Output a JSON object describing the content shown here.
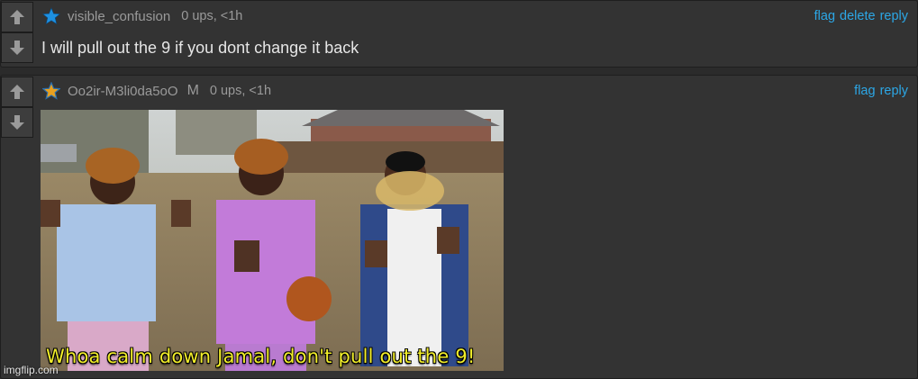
{
  "comments": [
    {
      "username": "visible_confusion",
      "stats": "0 ups, <1h",
      "actions": {
        "flag": "flag",
        "delete": "delete",
        "reply": "reply"
      },
      "text": "I will pull out the 9 if you dont change it back",
      "star_color": "#1e90e0"
    },
    {
      "username": "Oo2ir-M3li0da5oO",
      "mod_badge": "M",
      "stats": "0 ups, <1h",
      "actions": {
        "flag": "flag",
        "reply": "reply"
      },
      "meme_caption": "Whoa calm down Jamal, don't pull out the 9!",
      "star_color": "#e8a020"
    }
  ],
  "watermark": "imgflip.com",
  "colors": {
    "link": "#2ca7e6",
    "caption": "#f2ee2a"
  }
}
